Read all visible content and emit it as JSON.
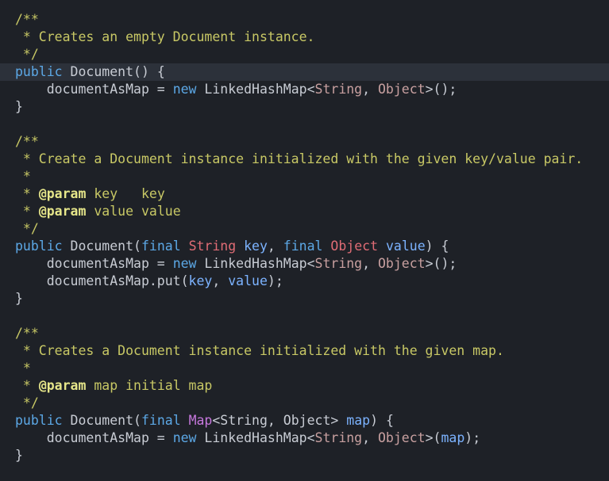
{
  "code": {
    "lines": [
      {
        "highlight": false,
        "tokens": [
          {
            "t": "c",
            "v": "/**"
          }
        ]
      },
      {
        "highlight": false,
        "tokens": [
          {
            "t": "c",
            "v": " * Creates an empty Document instance."
          }
        ]
      },
      {
        "highlight": false,
        "tokens": [
          {
            "t": "c",
            "v": " */"
          }
        ]
      },
      {
        "highlight": true,
        "tokens": [
          {
            "t": "kw",
            "v": "public"
          },
          {
            "t": "p",
            "v": " Document() {"
          }
        ]
      },
      {
        "highlight": false,
        "tokens": [
          {
            "t": "p",
            "v": "    documentAsMap = "
          },
          {
            "t": "kw",
            "v": "new"
          },
          {
            "t": "p",
            "v": " LinkedHashMap<"
          },
          {
            "t": "g",
            "v": "String"
          },
          {
            "t": "p",
            "v": ", "
          },
          {
            "t": "g",
            "v": "Object"
          },
          {
            "t": "p",
            "v": ">();"
          }
        ]
      },
      {
        "highlight": false,
        "tokens": [
          {
            "t": "p",
            "v": "}"
          }
        ]
      },
      {
        "highlight": false,
        "tokens": []
      },
      {
        "highlight": false,
        "tokens": [
          {
            "t": "c",
            "v": "/**"
          }
        ]
      },
      {
        "highlight": false,
        "tokens": [
          {
            "t": "c",
            "v": " * Create a Document instance initialized with the given key/value pair."
          }
        ]
      },
      {
        "highlight": false,
        "tokens": [
          {
            "t": "c",
            "v": " *"
          }
        ]
      },
      {
        "highlight": false,
        "tokens": [
          {
            "t": "c",
            "v": " * "
          },
          {
            "t": "tag",
            "v": "@param"
          },
          {
            "t": "c",
            "v": " key   key"
          }
        ]
      },
      {
        "highlight": false,
        "tokens": [
          {
            "t": "c",
            "v": " * "
          },
          {
            "t": "tag",
            "v": "@param"
          },
          {
            "t": "c",
            "v": " value value"
          }
        ]
      },
      {
        "highlight": false,
        "tokens": [
          {
            "t": "c",
            "v": " */"
          }
        ]
      },
      {
        "highlight": false,
        "tokens": [
          {
            "t": "kw",
            "v": "public"
          },
          {
            "t": "p",
            "v": " Document("
          },
          {
            "t": "kw",
            "v": "final"
          },
          {
            "t": "p",
            "v": " "
          },
          {
            "t": "ty",
            "v": "String"
          },
          {
            "t": "p",
            "v": " "
          },
          {
            "t": "var",
            "v": "key"
          },
          {
            "t": "p",
            "v": ", "
          },
          {
            "t": "kw",
            "v": "final"
          },
          {
            "t": "p",
            "v": " "
          },
          {
            "t": "ty",
            "v": "Object"
          },
          {
            "t": "p",
            "v": " "
          },
          {
            "t": "var",
            "v": "value"
          },
          {
            "t": "p",
            "v": ") {"
          }
        ]
      },
      {
        "highlight": false,
        "tokens": [
          {
            "t": "p",
            "v": "    documentAsMap = "
          },
          {
            "t": "kw",
            "v": "new"
          },
          {
            "t": "p",
            "v": " LinkedHashMap<"
          },
          {
            "t": "g",
            "v": "String"
          },
          {
            "t": "p",
            "v": ", "
          },
          {
            "t": "g",
            "v": "Object"
          },
          {
            "t": "p",
            "v": ">();"
          }
        ]
      },
      {
        "highlight": false,
        "tokens": [
          {
            "t": "p",
            "v": "    documentAsMap.put("
          },
          {
            "t": "var",
            "v": "key"
          },
          {
            "t": "p",
            "v": ", "
          },
          {
            "t": "var",
            "v": "value"
          },
          {
            "t": "p",
            "v": ");"
          }
        ]
      },
      {
        "highlight": false,
        "tokens": [
          {
            "t": "p",
            "v": "}"
          }
        ]
      },
      {
        "highlight": false,
        "tokens": []
      },
      {
        "highlight": false,
        "tokens": [
          {
            "t": "c",
            "v": "/**"
          }
        ]
      },
      {
        "highlight": false,
        "tokens": [
          {
            "t": "c",
            "v": " * Creates a Document instance initialized with the given map."
          }
        ]
      },
      {
        "highlight": false,
        "tokens": [
          {
            "t": "c",
            "v": " *"
          }
        ]
      },
      {
        "highlight": false,
        "tokens": [
          {
            "t": "c",
            "v": " * "
          },
          {
            "t": "tag",
            "v": "@param"
          },
          {
            "t": "c",
            "v": " map initial map"
          }
        ]
      },
      {
        "highlight": false,
        "tokens": [
          {
            "t": "c",
            "v": " */"
          }
        ]
      },
      {
        "highlight": false,
        "tokens": [
          {
            "t": "kw",
            "v": "public"
          },
          {
            "t": "p",
            "v": " Document("
          },
          {
            "t": "kw",
            "v": "final"
          },
          {
            "t": "p",
            "v": " "
          },
          {
            "t": "m",
            "v": "Map"
          },
          {
            "t": "p",
            "v": "<String, Object> "
          },
          {
            "t": "var",
            "v": "map"
          },
          {
            "t": "p",
            "v": ") {"
          }
        ]
      },
      {
        "highlight": false,
        "tokens": [
          {
            "t": "p",
            "v": "    documentAsMap = "
          },
          {
            "t": "kw",
            "v": "new"
          },
          {
            "t": "p",
            "v": " LinkedHashMap<"
          },
          {
            "t": "g",
            "v": "String"
          },
          {
            "t": "p",
            "v": ", "
          },
          {
            "t": "g",
            "v": "Object"
          },
          {
            "t": "p",
            "v": ">("
          },
          {
            "t": "var",
            "v": "map"
          },
          {
            "t": "p",
            "v": ");"
          }
        ]
      },
      {
        "highlight": false,
        "tokens": [
          {
            "t": "p",
            "v": "}"
          }
        ]
      }
    ]
  }
}
